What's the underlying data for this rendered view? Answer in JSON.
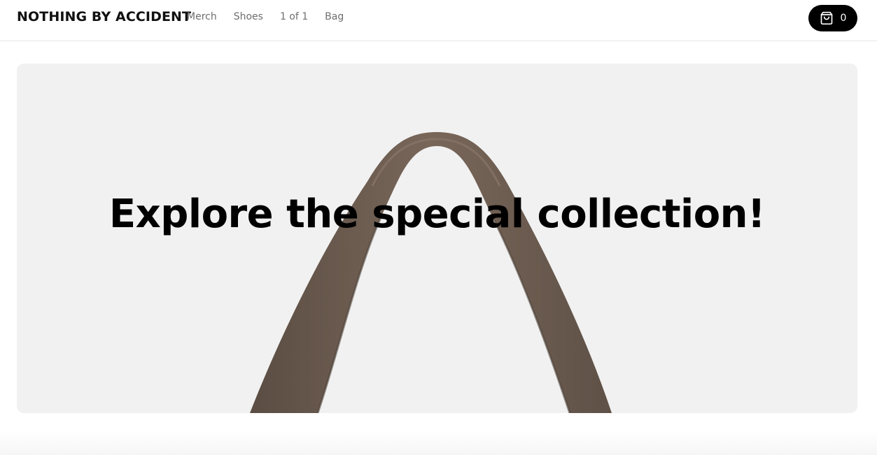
{
  "header": {
    "brand": "NOTHING BY ACCIDENT",
    "nav": [
      {
        "label": "Merch"
      },
      {
        "label": "Shoes"
      },
      {
        "label": "1 of 1"
      },
      {
        "label": "Bag"
      }
    ],
    "cart": {
      "icon": "shopping-bag-icon",
      "count": "0"
    }
  },
  "hero": {
    "title": "Explore the special collection!",
    "image": "tote-bag-handles",
    "background_color": "#f1f1f1",
    "strap_color": "#6f5f53"
  }
}
